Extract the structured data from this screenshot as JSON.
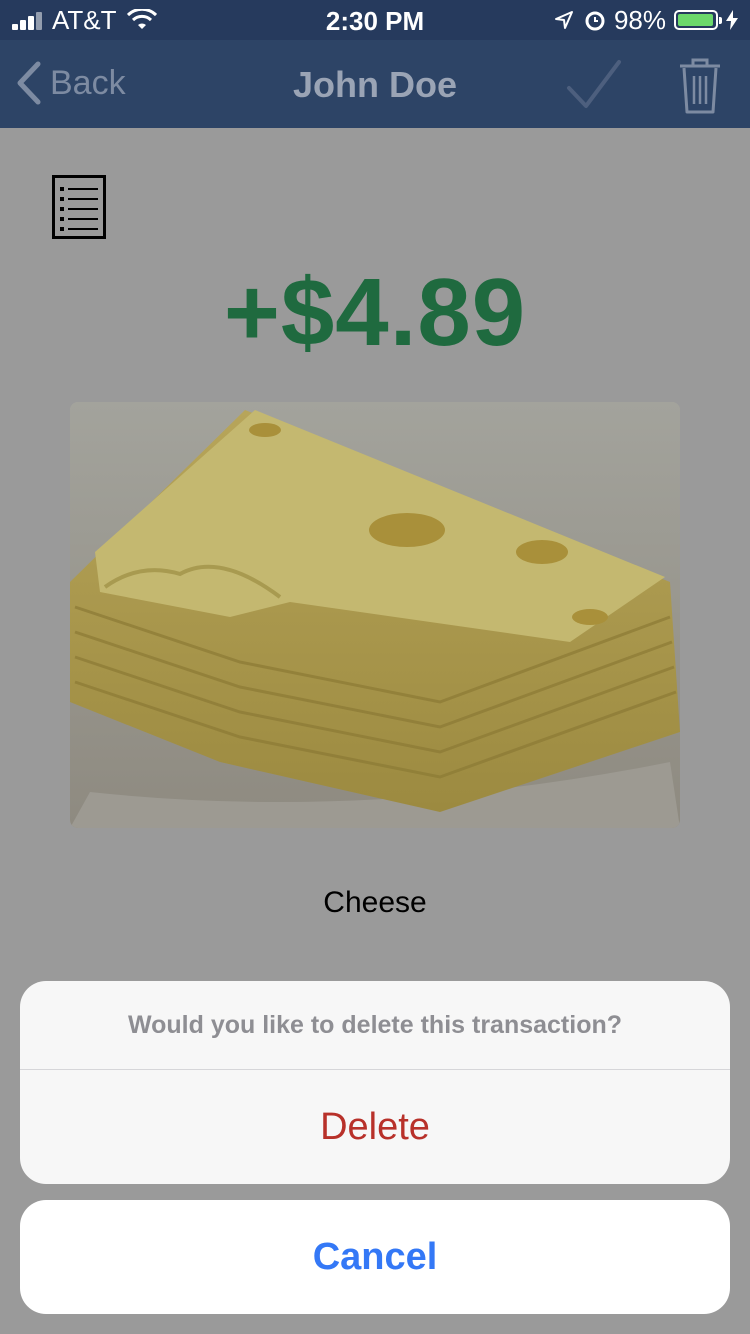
{
  "status_bar": {
    "carrier": "AT&T",
    "time": "2:30 PM",
    "battery_text": "98%",
    "battery_level": 0.98,
    "icons": [
      "signal-icon",
      "wifi-icon",
      "location-arrow-icon",
      "alarm-icon",
      "battery-icon",
      "charging-bolt-icon"
    ]
  },
  "nav": {
    "back_label": "Back",
    "title": "John Doe",
    "icons": [
      "chevron-left-icon",
      "checkmark-icon",
      "trash-icon"
    ]
  },
  "transaction": {
    "list_icon": "list-icon",
    "amount": "+$4.89",
    "amount_color": "#1f6a3f",
    "image_subject": "stacked cheese slices photo",
    "name": "Cheese"
  },
  "action_sheet": {
    "message": "Would you like to delete this transaction?",
    "delete_label": "Delete",
    "cancel_label": "Cancel",
    "delete_color": "#b8312a",
    "cancel_color": "#3478f6"
  }
}
